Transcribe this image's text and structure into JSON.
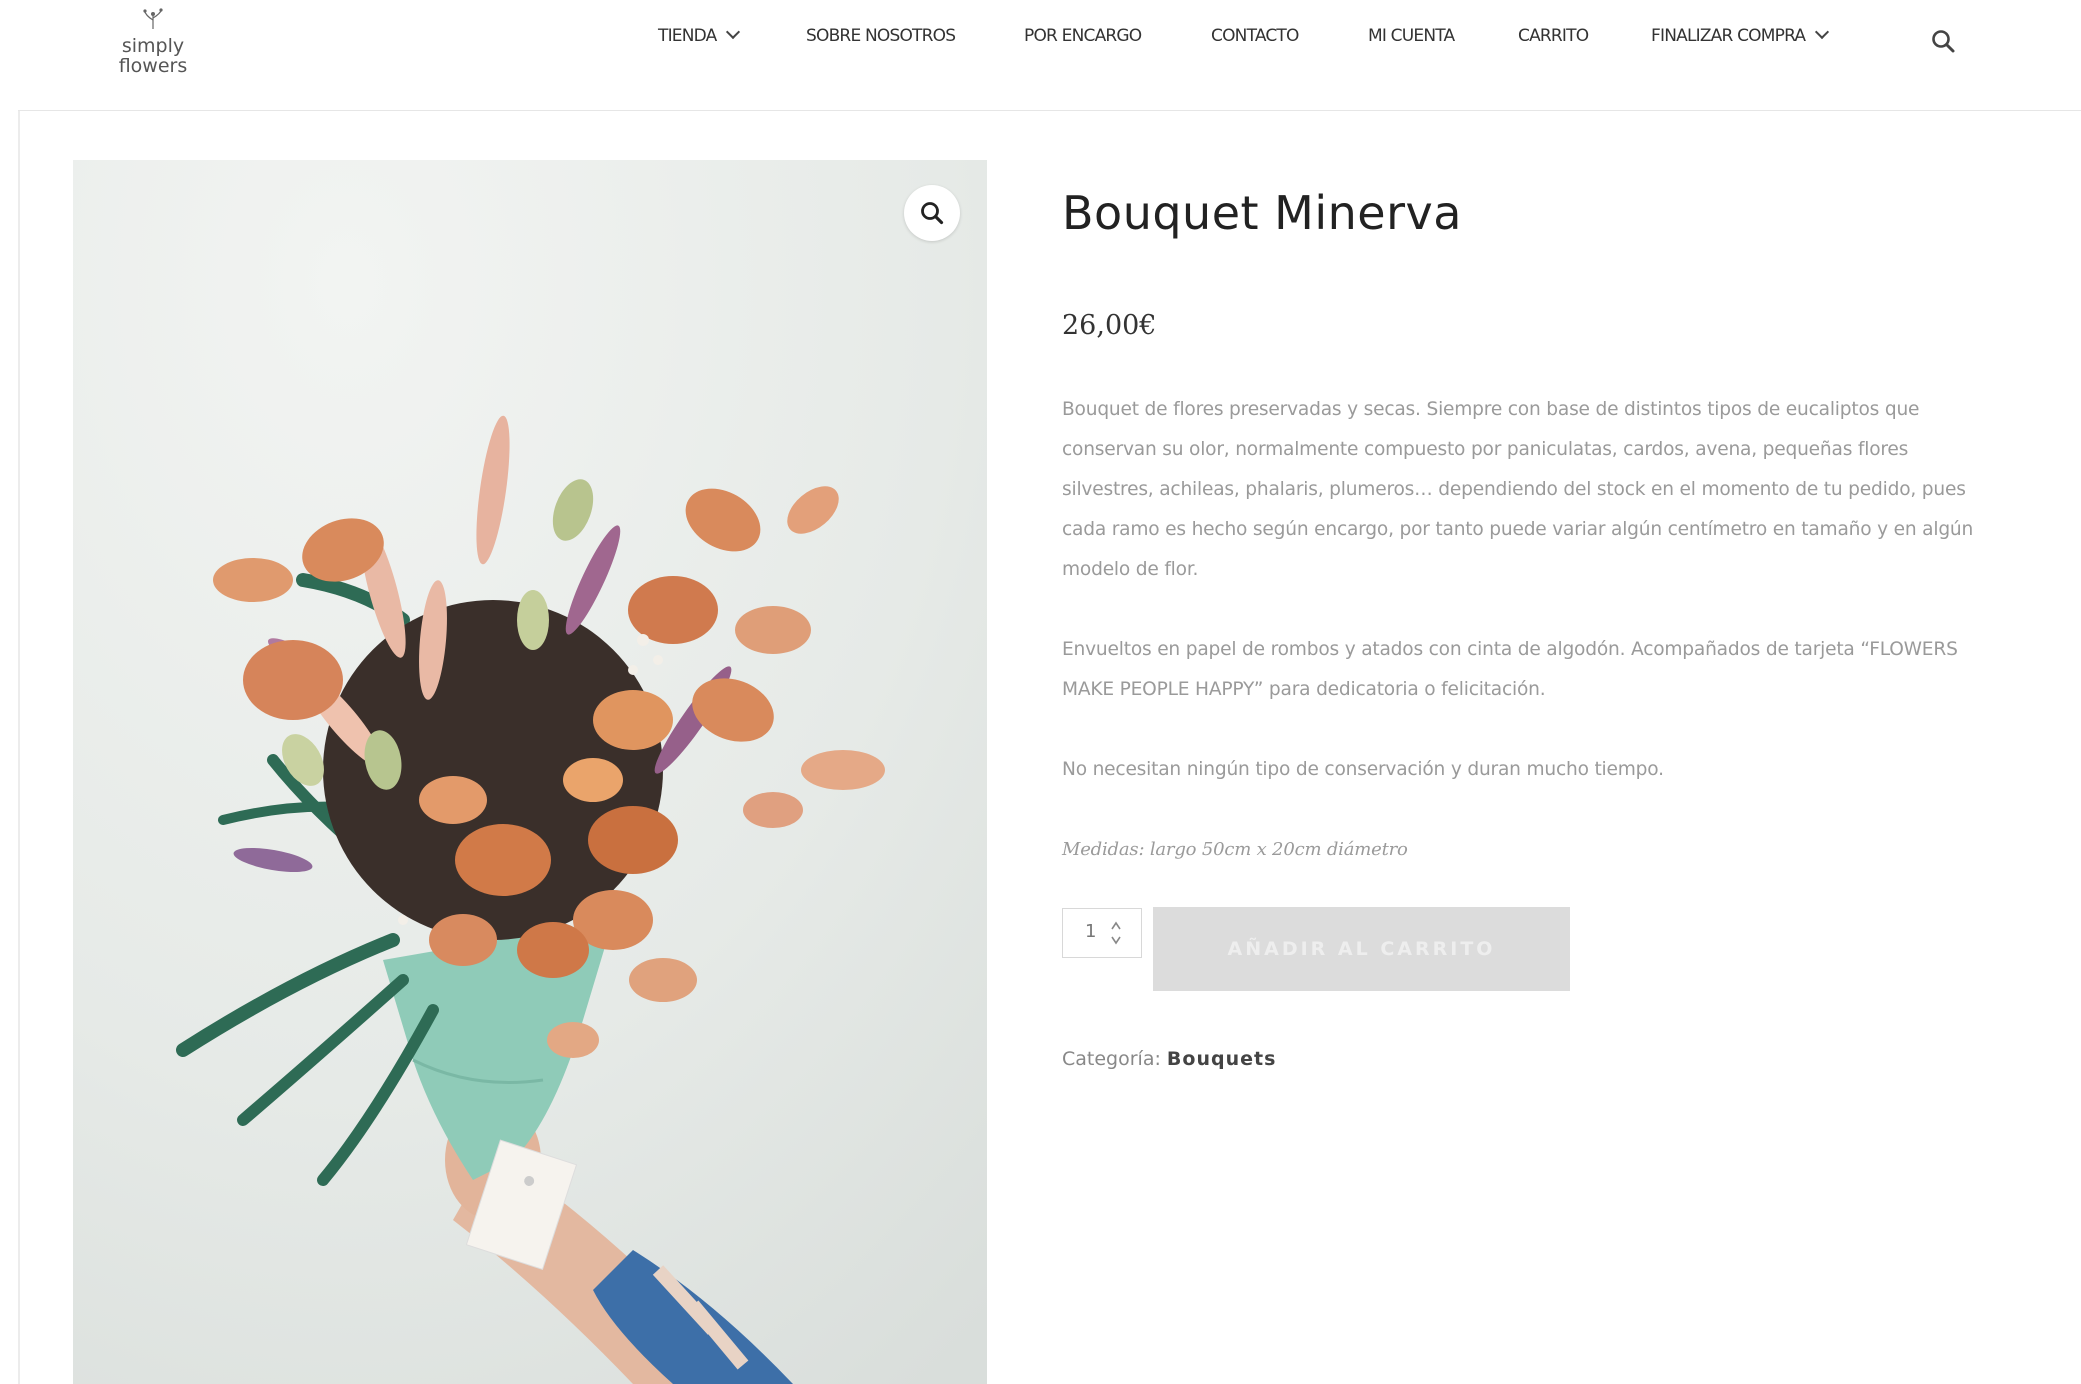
{
  "header": {
    "logo_text_line1": "simply",
    "logo_text_line2": "flowers",
    "nav": [
      {
        "label": "TIENDA",
        "has_dropdown": true
      },
      {
        "label": "SOBRE NOSOTROS",
        "has_dropdown": false
      },
      {
        "label": "POR ENCARGO",
        "has_dropdown": false
      },
      {
        "label": "CONTACTO",
        "has_dropdown": false
      },
      {
        "label": "MI CUENTA",
        "has_dropdown": false
      },
      {
        "label": "CARRITO",
        "has_dropdown": false
      },
      {
        "label": "FINALIZAR COMPRA",
        "has_dropdown": true
      }
    ],
    "search_icon": "search-icon"
  },
  "product": {
    "image_zoom_icon": "zoom-icon",
    "title": "Bouquet Minerva",
    "price": "26,00€",
    "description": [
      "Bouquet de flores preservadas y secas. Siempre con base de distintos tipos de eucaliptos que conservan su olor, normalmente compuesto por paniculatas, cardos, avena, pequeñas flores silvestres, achileas, phalaris, plumeros… dependiendo del stock en el momento de tu pedido, pues cada ramo es hecho según encargo, por tanto puede variar algún centímetro en tamaño y en algún modelo de flor.",
      "Envueltos en papel de rombos y atados con cinta de algodón. Acompañados de tarjeta “FLOWERS MAKE PEOPLE HAPPY” para dedicatoria o felicitación.",
      "No necesitan ningún tipo de conservación y duran mucho tiempo."
    ],
    "measures": "Medidas: largo 50cm x 20cm diámetro",
    "quantity": "1",
    "add_to_cart": "AÑADIR AL CARRITO",
    "category_label": "Categoría:",
    "category_value": "Bouquets"
  },
  "colors": {
    "text": "#222222",
    "muted": "#9a9a9a",
    "button_bg": "#dcdcdc",
    "leaf_green": "#2e6b55",
    "eucalyptus_orange": "#d98a5c",
    "paper_mint": "#8fcbb8"
  }
}
